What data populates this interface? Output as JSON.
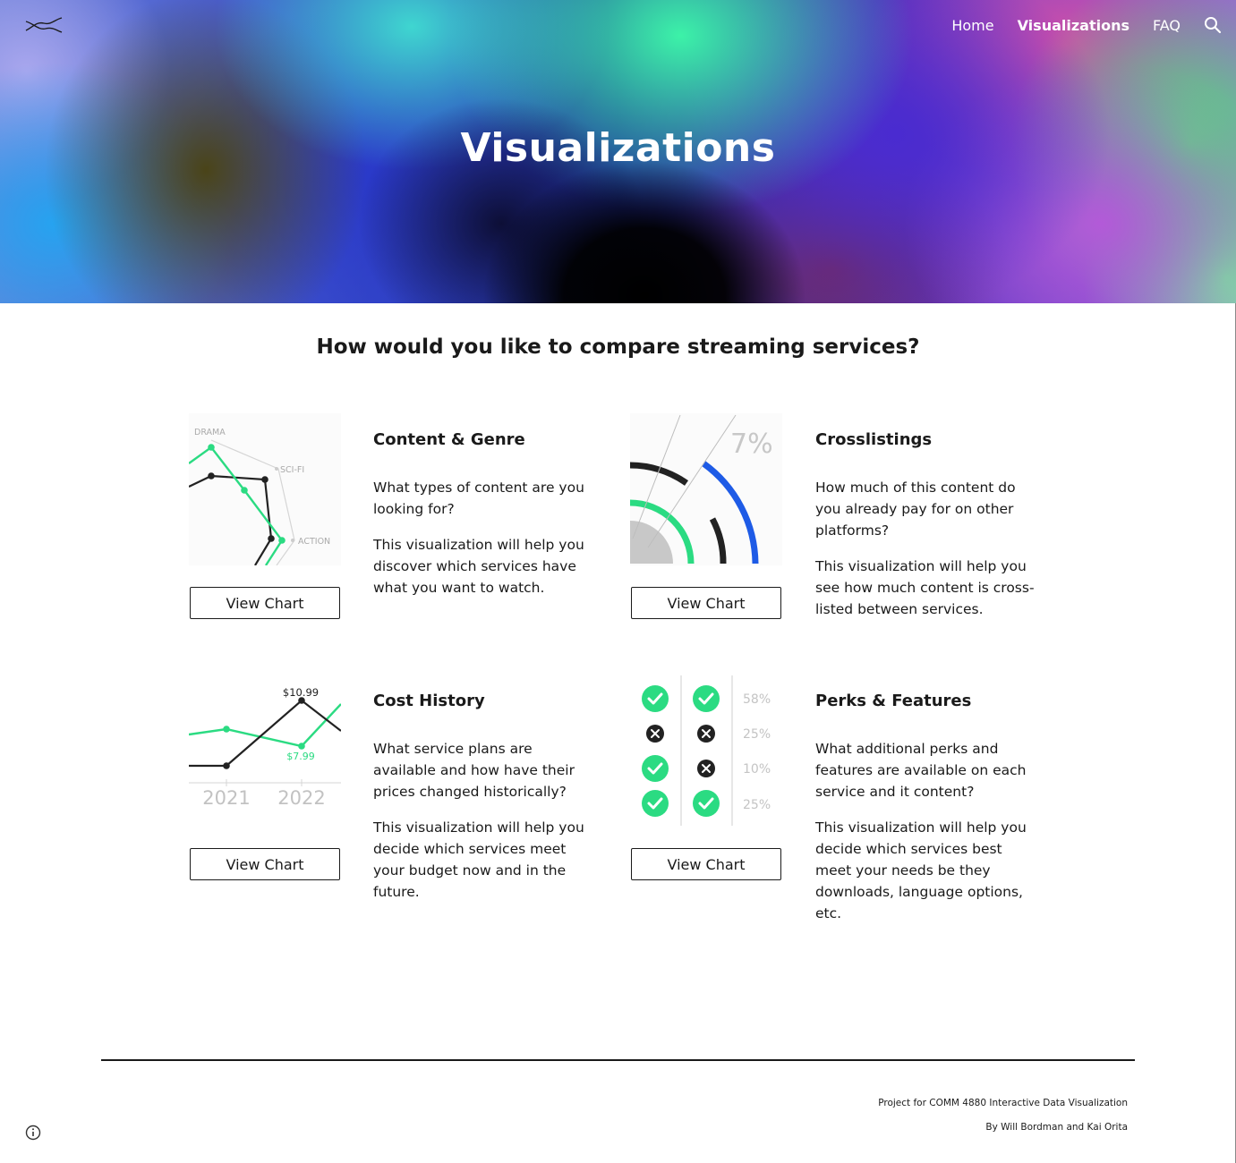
{
  "nav": {
    "logo": "site-logo",
    "items": [
      "Home",
      "Visualizations",
      "FAQ"
    ],
    "active": "Visualizations",
    "search_icon": "search-icon"
  },
  "hero": {
    "title": "Visualizations"
  },
  "main": {
    "question": "How would you like to compare streaming services?",
    "cards": [
      {
        "title": "Content & Genre",
        "question": "What types of content are you looking for?",
        "description": "This visualization will help you discover which services have what you want to watch.",
        "button": "View Chart",
        "thumbnail_labels": [
          "DRAMA",
          "SCI-FI",
          "ACTION"
        ]
      },
      {
        "title": "Crosslistings",
        "question": "How much of this content do you already pay for on other platforms?",
        "description": "This visualization will help you see how much content is cross-listed between services.",
        "button": "View Chart",
        "thumbnail_labels": [
          "7%"
        ]
      },
      {
        "title": "Cost History",
        "question": "What service plans are available and how have their prices changed historically?",
        "description": "This visualization will help you decide which services meet your budget now and in the future.",
        "button": "View Chart",
        "thumbnail_labels": [
          "$10.99",
          "$7.99",
          "2021",
          "2022"
        ]
      },
      {
        "title": "Perks & Features",
        "question": "What additional perks and features are available on each service and it content?",
        "description": "This visualization will help you decide which services best meet your needs be they downloads, language options, etc.",
        "button": "View Chart",
        "thumbnail_labels": [
          "58%",
          "25%",
          "10%",
          "25%"
        ]
      }
    ]
  },
  "colors": {
    "accent_green": "#2bdb82",
    "accent_blue": "#1e5be6",
    "dark": "#222222"
  },
  "footer": {
    "line1": "Project for COMM 4880 Interactive Data Visualization",
    "line2": "By Will Bordman and Kai Orita"
  }
}
